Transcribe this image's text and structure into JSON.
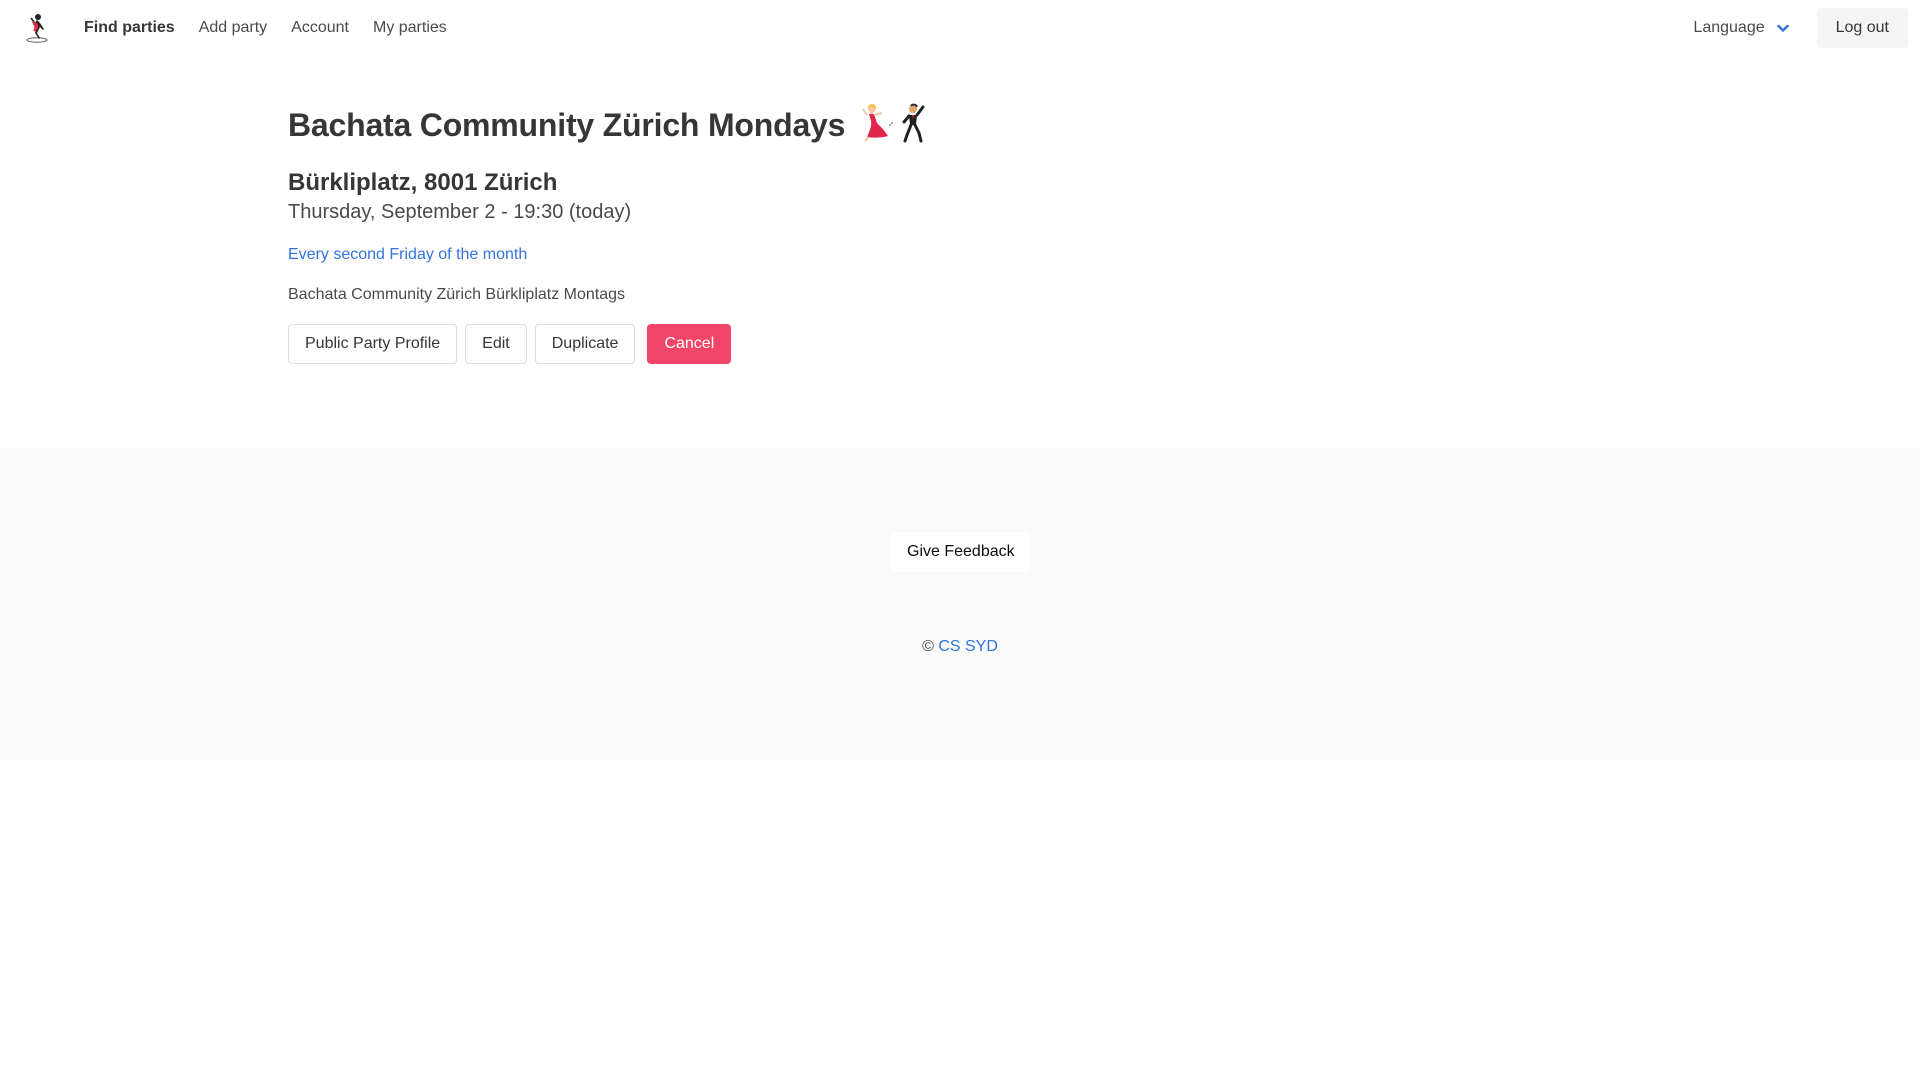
{
  "nav": {
    "logo": "dancer-logo-icon",
    "links": [
      "Find parties",
      "Add party",
      "Account",
      "My parties"
    ],
    "language_label": "Language",
    "logout_label": "Log out"
  },
  "party": {
    "title": "Bachata Community Zürich Mondays",
    "title_icons": [
      "woman-dancing-icon",
      "man-dancing-icon"
    ],
    "location": "Bürkliplatz, 8001 Zürich",
    "datetime": "Thursday, September 2 - 19:30 (today)",
    "recurrence": "Every second Friday of the month",
    "description": "Bachata Community Zürich Bürkliplatz Montags"
  },
  "actions": {
    "public_profile": "Public Party Profile",
    "edit": "Edit",
    "duplicate": "Duplicate",
    "cancel": "Cancel"
  },
  "footer": {
    "feedback": "Give Feedback",
    "copyright_symbol": "©",
    "copyright_link": "CS SYD"
  },
  "colors": {
    "link": "#3273dc",
    "danger": "#f14668",
    "footer_bg": "#fafafa"
  }
}
